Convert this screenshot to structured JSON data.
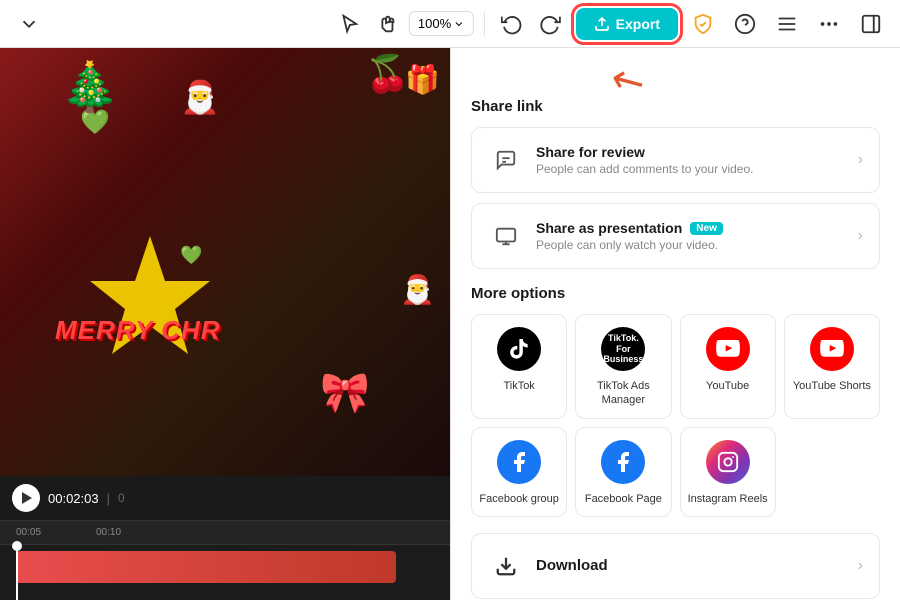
{
  "toolbar": {
    "zoom_level": "100%",
    "export_label": "Export",
    "undo_tooltip": "Undo",
    "redo_tooltip": "Redo"
  },
  "dropdown": {
    "arrow_symbol": "↖",
    "share_link_title": "Share link",
    "share_for_review_title": "Share for review",
    "share_for_review_desc": "People can add comments to your video.",
    "share_as_presentation_title": "Share as presentation",
    "share_as_presentation_badge": "New",
    "share_as_presentation_desc": "People can only watch your video.",
    "more_options_title": "More options",
    "download_label": "Download"
  },
  "social_items": [
    {
      "id": "tiktok",
      "label": "TikTok",
      "icon_type": "tiktok"
    },
    {
      "id": "tiktok-ads",
      "label": "TikTok Ads Manager",
      "icon_type": "tiktok-ads"
    },
    {
      "id": "youtube",
      "label": "YouTube",
      "icon_type": "youtube"
    },
    {
      "id": "youtube-shorts",
      "label": "YouTube Shorts",
      "icon_type": "youtube-shorts"
    },
    {
      "id": "facebook-group",
      "label": "Facebook group",
      "icon_type": "facebook"
    },
    {
      "id": "facebook-page",
      "label": "Facebook Page",
      "icon_type": "facebook"
    },
    {
      "id": "instagram-reels",
      "label": "Instagram Reels",
      "icon_type": "instagram"
    }
  ],
  "playback": {
    "timestamp": "00:02:03",
    "marker": "0"
  },
  "timeline": {
    "mark1": "00:05",
    "mark2": "00:10"
  }
}
